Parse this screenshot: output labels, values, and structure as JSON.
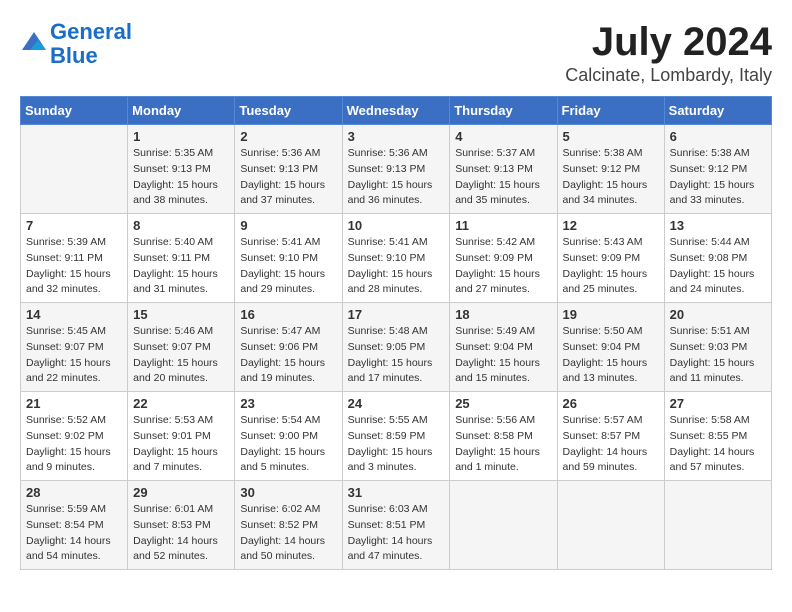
{
  "logo": {
    "line1": "General",
    "line2": "Blue"
  },
  "title": "July 2024",
  "location": "Calcinate, Lombardy, Italy",
  "weekdays": [
    "Sunday",
    "Monday",
    "Tuesday",
    "Wednesday",
    "Thursday",
    "Friday",
    "Saturday"
  ],
  "weeks": [
    [
      {
        "day": "",
        "info": ""
      },
      {
        "day": "1",
        "info": "Sunrise: 5:35 AM\nSunset: 9:13 PM\nDaylight: 15 hours\nand 38 minutes."
      },
      {
        "day": "2",
        "info": "Sunrise: 5:36 AM\nSunset: 9:13 PM\nDaylight: 15 hours\nand 37 minutes."
      },
      {
        "day": "3",
        "info": "Sunrise: 5:36 AM\nSunset: 9:13 PM\nDaylight: 15 hours\nand 36 minutes."
      },
      {
        "day": "4",
        "info": "Sunrise: 5:37 AM\nSunset: 9:13 PM\nDaylight: 15 hours\nand 35 minutes."
      },
      {
        "day": "5",
        "info": "Sunrise: 5:38 AM\nSunset: 9:12 PM\nDaylight: 15 hours\nand 34 minutes."
      },
      {
        "day": "6",
        "info": "Sunrise: 5:38 AM\nSunset: 9:12 PM\nDaylight: 15 hours\nand 33 minutes."
      }
    ],
    [
      {
        "day": "7",
        "info": "Sunrise: 5:39 AM\nSunset: 9:11 PM\nDaylight: 15 hours\nand 32 minutes."
      },
      {
        "day": "8",
        "info": "Sunrise: 5:40 AM\nSunset: 9:11 PM\nDaylight: 15 hours\nand 31 minutes."
      },
      {
        "day": "9",
        "info": "Sunrise: 5:41 AM\nSunset: 9:10 PM\nDaylight: 15 hours\nand 29 minutes."
      },
      {
        "day": "10",
        "info": "Sunrise: 5:41 AM\nSunset: 9:10 PM\nDaylight: 15 hours\nand 28 minutes."
      },
      {
        "day": "11",
        "info": "Sunrise: 5:42 AM\nSunset: 9:09 PM\nDaylight: 15 hours\nand 27 minutes."
      },
      {
        "day": "12",
        "info": "Sunrise: 5:43 AM\nSunset: 9:09 PM\nDaylight: 15 hours\nand 25 minutes."
      },
      {
        "day": "13",
        "info": "Sunrise: 5:44 AM\nSunset: 9:08 PM\nDaylight: 15 hours\nand 24 minutes."
      }
    ],
    [
      {
        "day": "14",
        "info": "Sunrise: 5:45 AM\nSunset: 9:07 PM\nDaylight: 15 hours\nand 22 minutes."
      },
      {
        "day": "15",
        "info": "Sunrise: 5:46 AM\nSunset: 9:07 PM\nDaylight: 15 hours\nand 20 minutes."
      },
      {
        "day": "16",
        "info": "Sunrise: 5:47 AM\nSunset: 9:06 PM\nDaylight: 15 hours\nand 19 minutes."
      },
      {
        "day": "17",
        "info": "Sunrise: 5:48 AM\nSunset: 9:05 PM\nDaylight: 15 hours\nand 17 minutes."
      },
      {
        "day": "18",
        "info": "Sunrise: 5:49 AM\nSunset: 9:04 PM\nDaylight: 15 hours\nand 15 minutes."
      },
      {
        "day": "19",
        "info": "Sunrise: 5:50 AM\nSunset: 9:04 PM\nDaylight: 15 hours\nand 13 minutes."
      },
      {
        "day": "20",
        "info": "Sunrise: 5:51 AM\nSunset: 9:03 PM\nDaylight: 15 hours\nand 11 minutes."
      }
    ],
    [
      {
        "day": "21",
        "info": "Sunrise: 5:52 AM\nSunset: 9:02 PM\nDaylight: 15 hours\nand 9 minutes."
      },
      {
        "day": "22",
        "info": "Sunrise: 5:53 AM\nSunset: 9:01 PM\nDaylight: 15 hours\nand 7 minutes."
      },
      {
        "day": "23",
        "info": "Sunrise: 5:54 AM\nSunset: 9:00 PM\nDaylight: 15 hours\nand 5 minutes."
      },
      {
        "day": "24",
        "info": "Sunrise: 5:55 AM\nSunset: 8:59 PM\nDaylight: 15 hours\nand 3 minutes."
      },
      {
        "day": "25",
        "info": "Sunrise: 5:56 AM\nSunset: 8:58 PM\nDaylight: 15 hours\nand 1 minute."
      },
      {
        "day": "26",
        "info": "Sunrise: 5:57 AM\nSunset: 8:57 PM\nDaylight: 14 hours\nand 59 minutes."
      },
      {
        "day": "27",
        "info": "Sunrise: 5:58 AM\nSunset: 8:55 PM\nDaylight: 14 hours\nand 57 minutes."
      }
    ],
    [
      {
        "day": "28",
        "info": "Sunrise: 5:59 AM\nSunset: 8:54 PM\nDaylight: 14 hours\nand 54 minutes."
      },
      {
        "day": "29",
        "info": "Sunrise: 6:01 AM\nSunset: 8:53 PM\nDaylight: 14 hours\nand 52 minutes."
      },
      {
        "day": "30",
        "info": "Sunrise: 6:02 AM\nSunset: 8:52 PM\nDaylight: 14 hours\nand 50 minutes."
      },
      {
        "day": "31",
        "info": "Sunrise: 6:03 AM\nSunset: 8:51 PM\nDaylight: 14 hours\nand 47 minutes."
      },
      {
        "day": "",
        "info": ""
      },
      {
        "day": "",
        "info": ""
      },
      {
        "day": "",
        "info": ""
      }
    ]
  ]
}
